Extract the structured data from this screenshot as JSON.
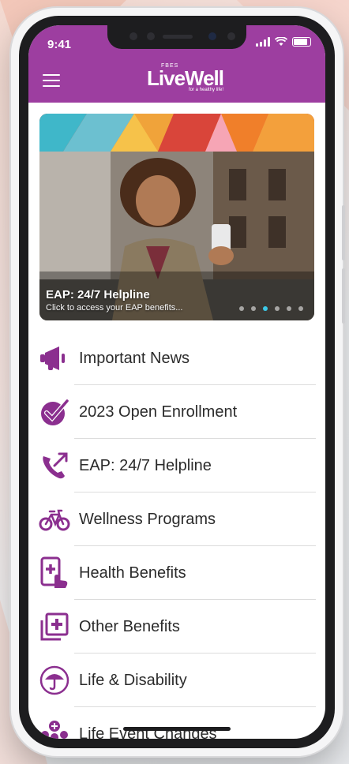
{
  "status_bar": {
    "time": "9:41"
  },
  "header": {
    "logo_brand": "FBES",
    "logo_name": "LiveWell",
    "logo_tagline": "for a healthy life!"
  },
  "hero": {
    "title": "EAP: 24/7 Helpline",
    "subtitle": "Click to access your EAP benefits...",
    "slide_count": 6,
    "active_slide": 3
  },
  "menu": {
    "items": [
      {
        "label": "Important News",
        "icon": "megaphone-icon"
      },
      {
        "label": "2023 Open Enrollment",
        "icon": "checkmark-badge-icon"
      },
      {
        "label": "EAP: 24/7 Helpline",
        "icon": "phone-arrow-icon"
      },
      {
        "label": "Wellness Programs",
        "icon": "bicycle-icon"
      },
      {
        "label": "Health Benefits",
        "icon": "medical-tablet-icon"
      },
      {
        "label": "Other Benefits",
        "icon": "plus-cards-icon"
      },
      {
        "label": "Life & Disability",
        "icon": "umbrella-icon"
      },
      {
        "label": "Life Event Changes",
        "icon": "family-icon"
      }
    ]
  },
  "colors": {
    "brand_purple": "#9d3ea0",
    "icon_purple": "#8b2f8f",
    "active_dot": "#3cc8e6"
  }
}
